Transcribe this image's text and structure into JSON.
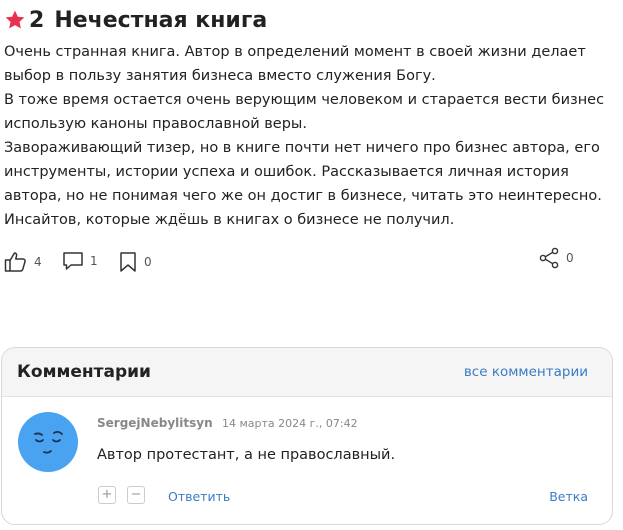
{
  "review": {
    "rating": "2",
    "title": "Нечестная книга",
    "paragraphs": [
      "Очень странная книга. Автор в определений момент в своей жизни делает выбор в пользу занятия бизнеса вместо служения Богу.",
      "В тоже время остается очень верующим человеком и старается вести бизнес использую каноны православной веры.",
      "Завораживающий тизер, но в книге почти нет ничего про бизнес автора, его инструменты, истории успеха и ошибок. Рассказывается личная история автора, но не понимая чего же он достиг в бизнесе, читать это неинтересно.",
      "Инсайтов, которые ждёшь в книгах о бизнесе не получил."
    ],
    "likes": "4",
    "comments_count": "1",
    "bookmarks": "0",
    "shares": "0",
    "star_color": "#e8304f"
  },
  "comments": {
    "header": "Комментарии",
    "all_link": "все комментарии",
    "item": {
      "author": "SergejNebylitsyn",
      "date": "14 марта 2024 г., 07:42",
      "text": "Автор протестант, а не православный.",
      "plus": "+",
      "minus": "−",
      "reply": "Ответить",
      "thread": "Ветка"
    }
  },
  "colors": {
    "link": "#3a7cc6",
    "avatar": "#4aa3f0"
  }
}
